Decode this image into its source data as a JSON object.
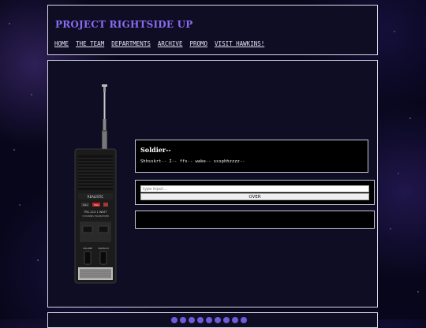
{
  "header": {
    "title": "PROJECT RIGHTSIDE UP",
    "nav": [
      "HOME",
      "THE TEAM",
      "DEPARTMENTS",
      "ARCHIVE",
      "PROMO",
      "VISIT HAWKINS!"
    ]
  },
  "radio": {
    "brand_label": "REALISTIC",
    "model_label": "TRC-214 1 WATT",
    "model_sub": "3 CHANNEL TRANSCEIVER",
    "volume_label": "VOLUME",
    "squelch_label": "SQUELCH",
    "button_labels": [
      "CALL",
      "TALK"
    ]
  },
  "message": {
    "sender": "Soldier--",
    "text": "Shhsskrt-- I-- ffs-- wake-- sssphhzzzz--"
  },
  "input": {
    "placeholder": "type input...",
    "button_label": "OVER"
  },
  "colors": {
    "title": "#8a6cf2",
    "panel_bg": "#0e0d24",
    "border": "#d8d8e8"
  }
}
